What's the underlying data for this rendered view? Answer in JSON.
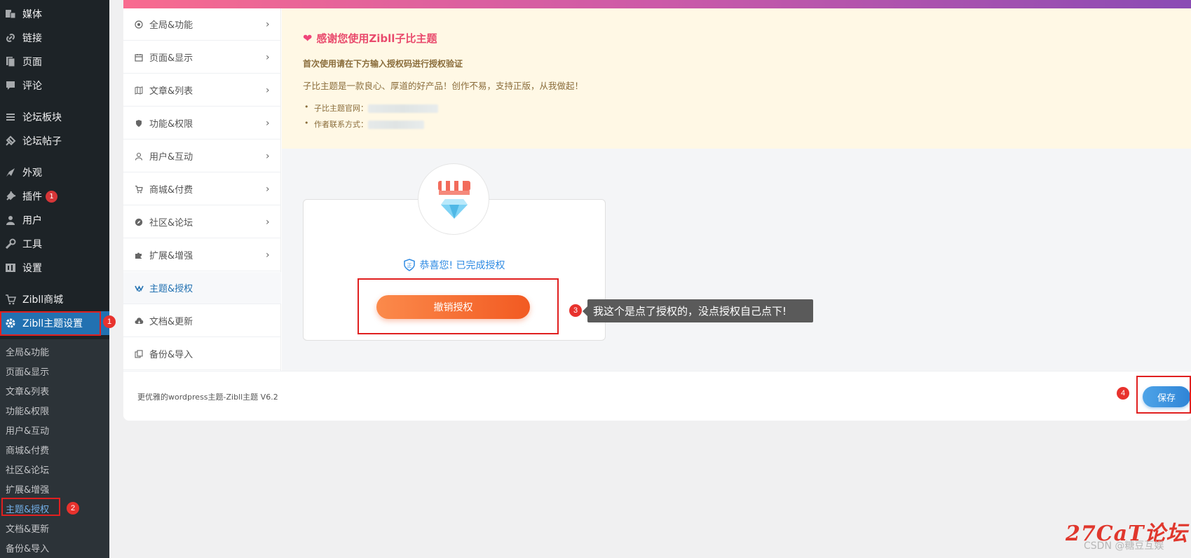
{
  "wp_menu": [
    {
      "label": "媒体",
      "icon": "media-icon"
    },
    {
      "label": "链接",
      "icon": "link-icon"
    },
    {
      "label": "页面",
      "icon": "page-icon"
    },
    {
      "label": "评论",
      "icon": "comment-icon"
    },
    {
      "label": "论坛板块",
      "icon": "forum-board-icon"
    },
    {
      "label": "论坛帖子",
      "icon": "forum-post-icon"
    },
    {
      "label": "外观",
      "icon": "appearance-icon"
    },
    {
      "label": "插件",
      "icon": "plugin-icon",
      "badge": "1"
    },
    {
      "label": "用户",
      "icon": "user-icon"
    },
    {
      "label": "工具",
      "icon": "tools-icon"
    },
    {
      "label": "设置",
      "icon": "settings-icon"
    },
    {
      "label": "Zibll商城",
      "icon": "cart-icon"
    },
    {
      "label": "Zibll主题设置",
      "icon": "gear-icon",
      "current": true
    }
  ],
  "wp_submenu": [
    "全局&功能",
    "页面&显示",
    "文章&列表",
    "功能&权限",
    "用户&互动",
    "商城&付费",
    "社区&论坛",
    "扩展&增强",
    "主题&授权",
    "文档&更新",
    "备份&导入"
  ],
  "wp_submenu_current": "主题&授权",
  "settings_nav": [
    {
      "label": "全局&功能",
      "icon": "target-icon"
    },
    {
      "label": "页面&显示",
      "icon": "calendar-icon"
    },
    {
      "label": "文章&列表",
      "icon": "map-icon"
    },
    {
      "label": "功能&权限",
      "icon": "shield-icon"
    },
    {
      "label": "用户&互动",
      "icon": "user-outline-icon"
    },
    {
      "label": "商城&付费",
      "icon": "cart-icon"
    },
    {
      "label": "社区&论坛",
      "icon": "compass-icon"
    },
    {
      "label": "扩展&增强",
      "icon": "puzzle-icon"
    },
    {
      "label": "主题&授权",
      "icon": "authorize-icon",
      "active": true
    },
    {
      "label": "文档&更新",
      "icon": "cloud-icon"
    },
    {
      "label": "备份&导入",
      "icon": "copy-icon"
    }
  ],
  "welcome": {
    "title": "感谢您使用Zibll子比主题",
    "bold": "首次使用请在下方输入授权码进行授权验证",
    "desc": "子比主题是一款良心、厚道的好产品！创作不易，支持正版，从我做起！",
    "site_label": "子比主题官网：",
    "contact_label": "作者联系方式："
  },
  "auth": {
    "status": "恭喜您! 已完成授权",
    "revoke_label": "撤销授权"
  },
  "footer": {
    "text": "更优雅的wordpress主题-Zibll主题 V6.2",
    "save_label": "保存"
  },
  "annotations": {
    "n1": "1",
    "n2": "2",
    "n3": "3",
    "n4": "4",
    "tooltip": "我这个是点了授权的，没点授权自己点下!"
  },
  "watermark": "27CaT论坛",
  "credit": "CSDN @糖豆互娱",
  "colors": {
    "sidebar_bg": "#1d2327",
    "wp_blue": "#2271b1",
    "accent_pink": "#e94b6d",
    "revoke_orange": "#f25a22",
    "save_blue": "#2f84d6",
    "annotation_red": "#e02020"
  }
}
